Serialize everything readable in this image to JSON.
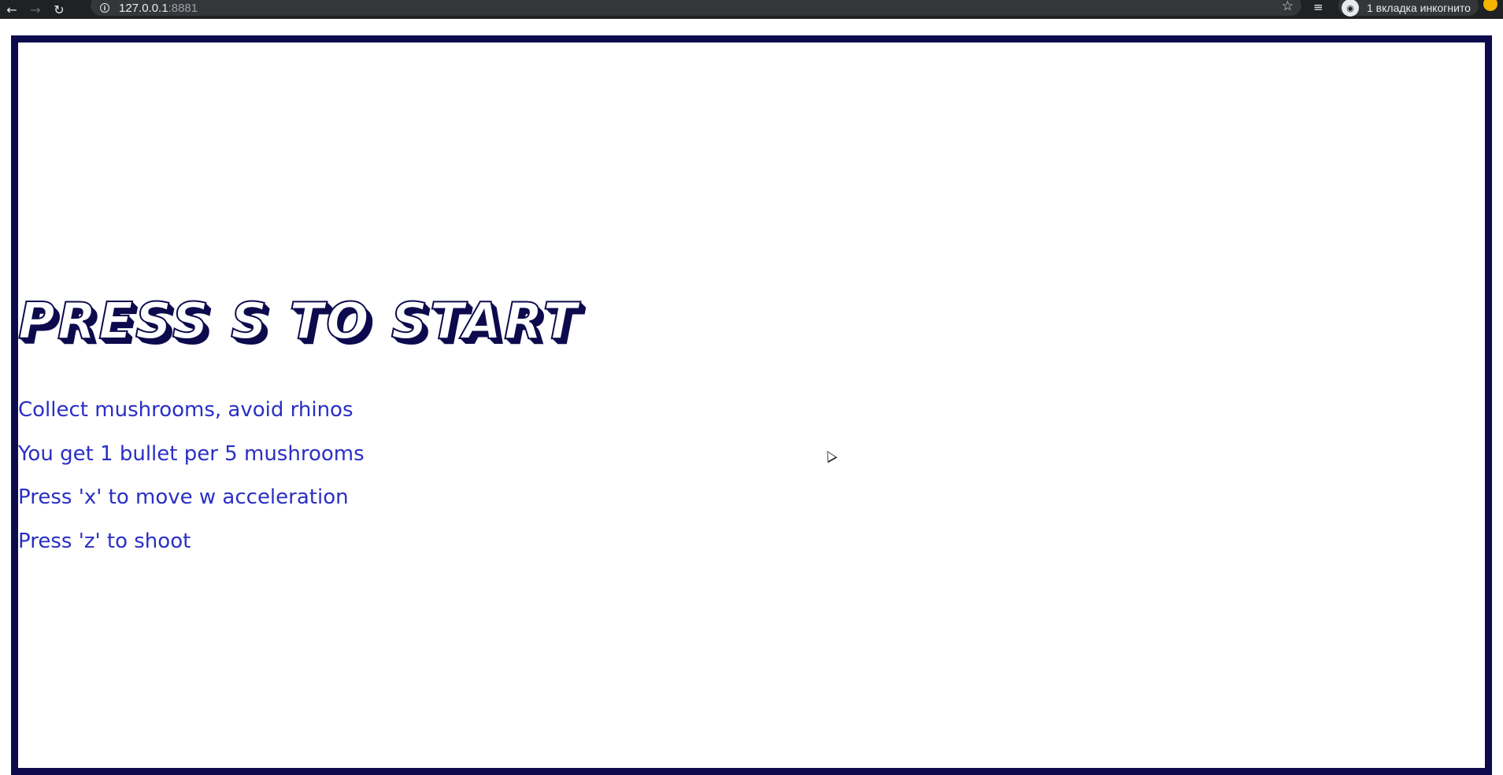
{
  "browser": {
    "url_host": "127.0.0.1",
    "url_port": ":8881",
    "incognito_label": "1 вкладка инкогнито",
    "icons": {
      "back": "arrow-left",
      "forward": "arrow-right",
      "reload": "reload",
      "info": "info",
      "bookmark": "star",
      "reading_list": "reading-list",
      "incognito": "incognito-avatar",
      "profile": "profile"
    }
  },
  "game": {
    "title": "Press s to start",
    "instructions": [
      "Collect mushrooms, avoid rhinos",
      "You get 1 bullet per 5 mushrooms",
      "Press 'x' to move w acceleration",
      "Press 'z' to shoot"
    ]
  },
  "colors": {
    "frame": "#0d0b4d",
    "instruction_text": "#2a2fc4",
    "chrome_bg": "#202124"
  }
}
